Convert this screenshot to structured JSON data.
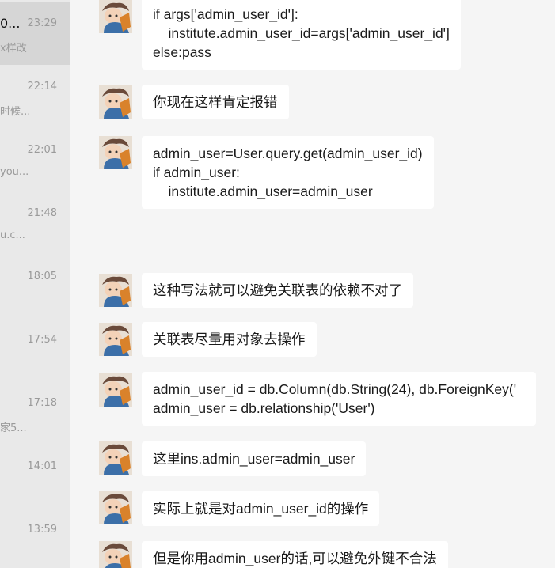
{
  "sidebar": {
    "items": [
      {
        "name": "0...",
        "time": "23:29",
        "snippet": "x样改"
      },
      {
        "name": "",
        "time": "22:14",
        "snippet": "时候..."
      },
      {
        "name": "",
        "time": "22:01",
        "snippet": "you..."
      },
      {
        "name": "",
        "time": "21:48",
        "snippet": "u.c..."
      },
      {
        "name": "",
        "time": "18:05",
        "snippet": ""
      },
      {
        "name": "",
        "time": "17:54",
        "snippet": ""
      },
      {
        "name": "",
        "time": "17:18",
        "snippet": "家5..."
      },
      {
        "name": "",
        "time": "14:01",
        "snippet": ""
      },
      {
        "name": "",
        "time": "13:59",
        "snippet": ""
      }
    ]
  },
  "messages": [
    {
      "text": "if args['admin_user_id']:\n    institute.admin_user_id=args['admin_user_id']\nelse:pass"
    },
    {
      "text": "你现在这样肯定报错"
    },
    {
      "text": "admin_user=User.query.get(admin_user_id)\nif admin_user:\n    institute.admin_user=admin_user"
    },
    {
      "text": "这种写法就可以避免关联表的依赖不对了"
    },
    {
      "text": "关联表尽量用对象去操作"
    },
    {
      "text": "admin_user_id = db.Column(db.String(24), db.ForeignKey('\nadmin_user = db.relationship('User')"
    },
    {
      "text": "这里ins.admin_user=admin_user"
    },
    {
      "text": "实际上就是对admin_user_id的操作"
    },
    {
      "text": "但是你用admin_user的话,可以避免外键不合法"
    }
  ]
}
